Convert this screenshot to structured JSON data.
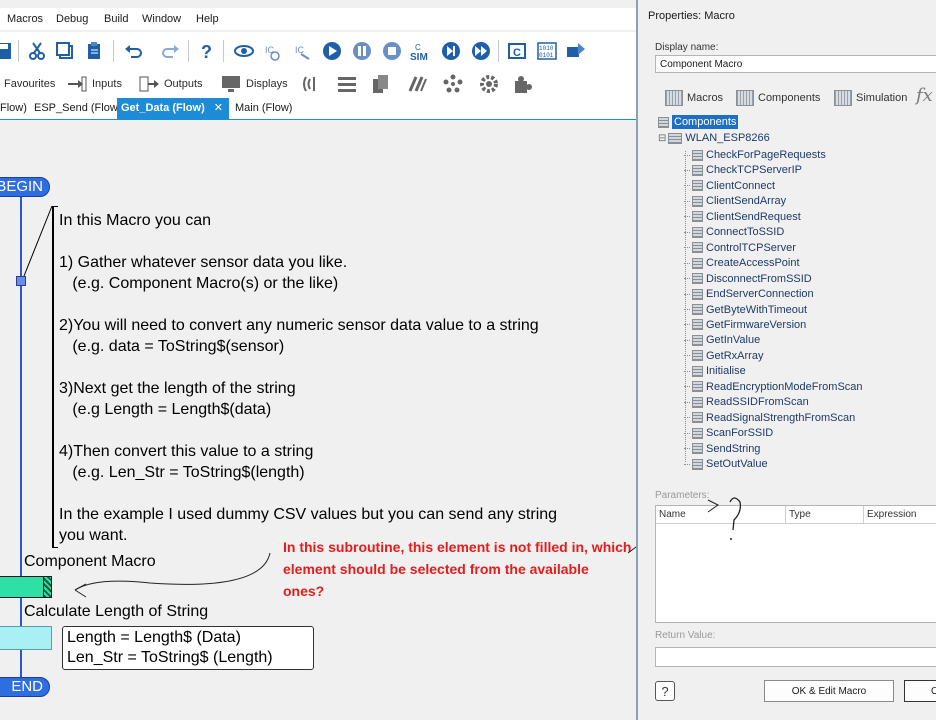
{
  "menu": [
    "Macros",
    "Debug",
    "Build",
    "Window",
    "Help"
  ],
  "toolbar2": {
    "favourites": "Favourites",
    "inputs": "Inputs",
    "outputs": "Outputs",
    "displays": "Displays"
  },
  "tabs": [
    {
      "label": "Flow)"
    },
    {
      "label": "ESP_Send (Flow)"
    },
    {
      "label": "Get_Data (Flow)",
      "close": "✕"
    },
    {
      "label": "Main (Flow)"
    }
  ],
  "flow": {
    "begin": "BEGIN",
    "end": "END",
    "note_lines": [
      "In this Macro you can",
      "",
      "1) Gather whatever sensor data you like.",
      "   (e.g. Component Macro(s) or the like)",
      "",
      "2)You will need to convert any numeric sensor data value to a string",
      "   (e.g. data = ToString$(sensor)",
      "",
      "3)Next get the length of the string",
      "   (e.g Length = Length$(data)",
      "",
      "4)Then convert this value to a string",
      "   (e.g. Len_Str = ToString$(length)",
      "",
      "In the example I used dummy CSV values but you can send any string",
      "you want."
    ],
    "component_macro_label": "Component Macro",
    "calc_label": "Calculate Length of String",
    "calc_lines": [
      "Length = Length$ (Data)",
      "Len_Str = ToString$ (Length)"
    ],
    "annotation": "In this subroutine, this element is not filled in, which element should be selected from the available ones?"
  },
  "dialog": {
    "title": "Properties: Macro",
    "display_name_label": "Display name:",
    "display_name_value": "Component Macro",
    "tabs": [
      "Macros",
      "Components",
      "Simulation"
    ],
    "fx": "fx",
    "tree_root": "Components",
    "component": "WLAN_ESP8266",
    "macros": [
      "CheckForPageRequests",
      "CheckTCPServerIP",
      "ClientConnect",
      "ClientSendArray",
      "ClientSendRequest",
      "ConnectToSSID",
      "ControlTCPServer",
      "CreateAccessPoint",
      "DisconnectFromSSID",
      "EndServerConnection",
      "GetByteWithTimeout",
      "GetFirmwareVersion",
      "GetInValue",
      "GetRxArray",
      "Initialise",
      "ReadEncryptionModeFromScan",
      "ReadSSIDFromScan",
      "ReadSignalStrengthFromScan",
      "ScanForSSID",
      "SendString",
      "SetOutValue"
    ],
    "params_label": "Parameters:",
    "param_cols": [
      "Name",
      "Type",
      "Expression"
    ],
    "retval_label": "Return Value:",
    "help": "?",
    "ok_edit": "OK & Edit Macro",
    "ok": "O"
  },
  "colors": {
    "accent": "#1d8bd6",
    "terminator": "#2f6ee0",
    "macro_fill": "#2fe0a6",
    "calc_fill": "#a8f0f4",
    "annotation_red": "#e21d1d"
  }
}
